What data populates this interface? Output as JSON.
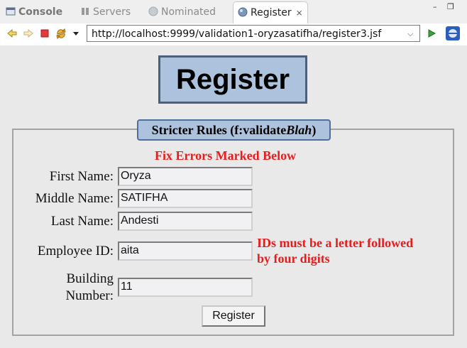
{
  "tabs": [
    {
      "label": "Console",
      "icon": "console-icon",
      "active": false
    },
    {
      "label": "Servers",
      "icon": "servers-icon",
      "active": false
    },
    {
      "label": "Nominated",
      "icon": "globe-icon",
      "active": false
    },
    {
      "label": "Register",
      "icon": "globe-icon",
      "active": true
    }
  ],
  "toolbar": {
    "url": "http://localhost:9999/validation1-oryzasatifha/register3.jsf",
    "icons": [
      "back-icon",
      "forward-icon",
      "stop-icon",
      "refresh-icon",
      "menu-dropdown-icon",
      "go-icon",
      "browser-icon"
    ]
  },
  "page": {
    "heading": "Register",
    "legend_prefix": "Stricter Rules (f:validate",
    "legend_italic": "Blah",
    "legend_suffix": ")",
    "form_error": "Fix Errors Marked Below",
    "fields": {
      "first_name": {
        "label": "First Name:",
        "value": "Oryza"
      },
      "middle_name": {
        "label": "Middle Name:",
        "value": "SATIFHA"
      },
      "last_name": {
        "label": "Last Name:",
        "value": "Andesti"
      },
      "employee_id": {
        "label": "Employee ID:",
        "value": "aita",
        "error_line1": "IDs must be a letter followed",
        "error_line2": "by four digits"
      },
      "building_number": {
        "label_line1": "Building",
        "label_line2": "Number:",
        "value": "11"
      }
    },
    "submit_label": "Register"
  },
  "colors": {
    "accent": "#adc3dd",
    "error": "#e81c1c"
  }
}
